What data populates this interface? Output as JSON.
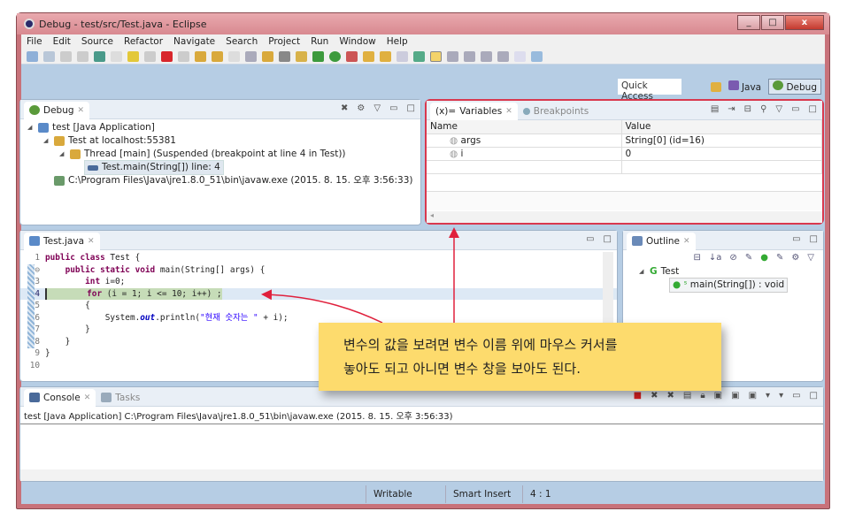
{
  "window": {
    "title": "Debug - test/src/Test.java - Eclipse",
    "buttons": [
      "minimize",
      "maximize",
      "close"
    ]
  },
  "menu": [
    "File",
    "Edit",
    "Source",
    "Refactor",
    "Navigate",
    "Search",
    "Project",
    "Run",
    "Window",
    "Help"
  ],
  "toolbar": {
    "quick_access": "Quick Access",
    "perspectives": [
      "Java",
      "Debug"
    ],
    "active_perspective": "Debug"
  },
  "debug_view": {
    "tab": "Debug",
    "tree": [
      {
        "label": "test [Java Application]",
        "level": 0
      },
      {
        "label": "Test at localhost:55381",
        "level": 1
      },
      {
        "label": "Thread [main] (Suspended (breakpoint at line 4 in Test))",
        "level": 2
      },
      {
        "label": "Test.main(String[]) line: 4",
        "level": 3
      },
      {
        "label": "C:\\Program Files\\Java\\jre1.8.0_51\\bin\\javaw.exe (2015. 8. 15. 오후 3:56:33)",
        "level": 1
      }
    ]
  },
  "variables_view": {
    "tabs": [
      "Variables",
      "Breakpoints"
    ],
    "columns": [
      "Name",
      "Value"
    ],
    "rows": [
      {
        "name": "args",
        "value": "String[0]  (id=16)"
      },
      {
        "name": "i",
        "value": "0"
      }
    ]
  },
  "editor": {
    "tab": "Test.java",
    "current_line": 4,
    "lines": [
      "public class Test {",
      "    public static void main(String[] args) {",
      "        int i=0;",
      "        for (i = 1; i <= 10; i++) ;",
      "        {",
      "            System.out.println(\"현재 숫자는 \" + i);",
      "        }",
      "    }",
      "}",
      ""
    ]
  },
  "outline": {
    "tab": "Outline",
    "class": "Test",
    "method": "main(String[]) : void"
  },
  "console": {
    "tabs": [
      "Console",
      "Tasks"
    ],
    "header": "test [Java Application] C:\\Program Files\\Java\\jre1.8.0_51\\bin\\javaw.exe (2015. 8. 15. 오후 3:56:33)"
  },
  "status": {
    "mode": "Writable",
    "insert": "Smart Insert",
    "position": "4 : 1"
  },
  "callout": {
    "line1": "변수의 값을 보려면 변수 이름 위에 마우스 커서를",
    "line2": "놓아도 되고 아니면 변수 창을 보아도 된다.",
    "color": "#fddb6d",
    "arrow_color": "#e0203c"
  }
}
